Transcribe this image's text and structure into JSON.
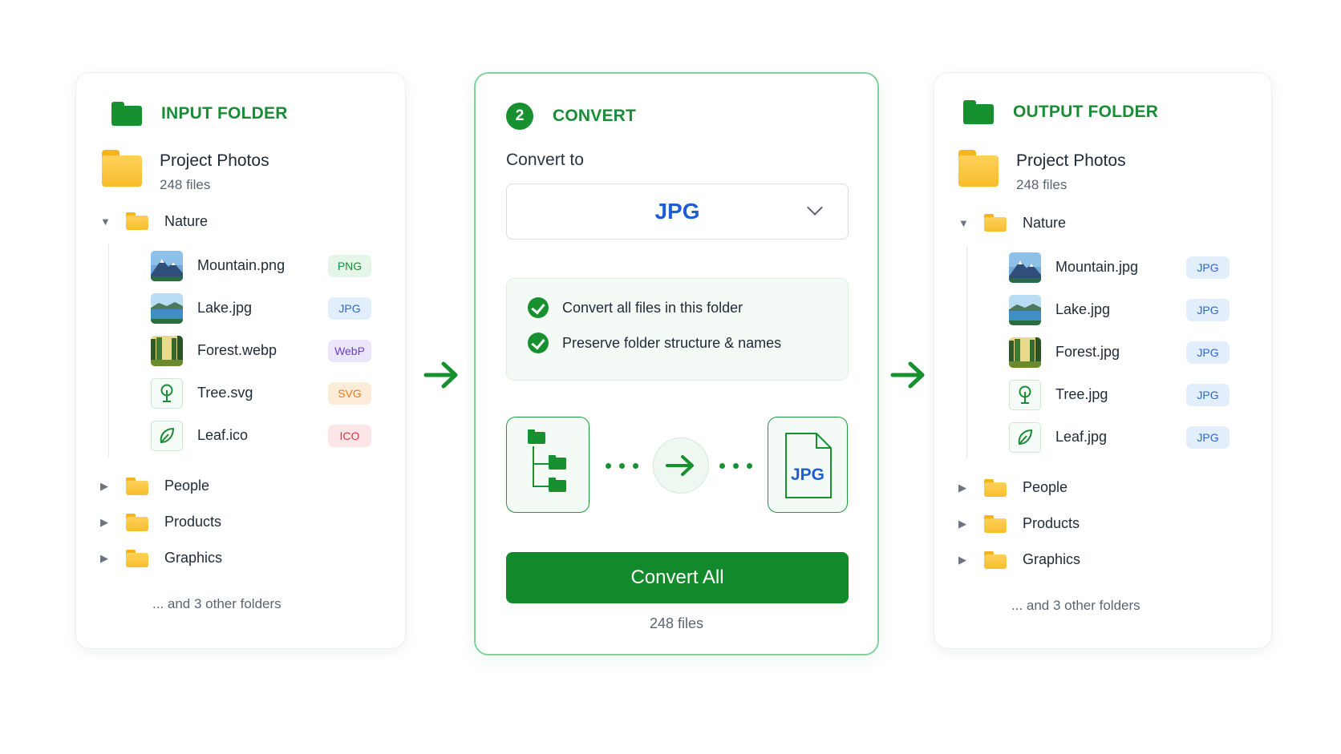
{
  "input": {
    "header": "INPUT FOLDER",
    "root": {
      "name": "Project Photos",
      "count": "248 files"
    },
    "expanded_folder": "Nature",
    "files": [
      {
        "name": "Mountain.png",
        "type": "PNG",
        "thumb": "mountain"
      },
      {
        "name": "Lake.jpg",
        "type": "JPG",
        "thumb": "lake"
      },
      {
        "name": "Forest.webp",
        "type": "WebP",
        "thumb": "forest"
      },
      {
        "name": "Tree.svg",
        "type": "SVG",
        "thumb": "tree-icon"
      },
      {
        "name": "Leaf.ico",
        "type": "ICO",
        "thumb": "leaf-icon"
      }
    ],
    "collapsed_folders": [
      "People",
      "Products",
      "Graphics"
    ],
    "other_folders": "... and 3 other folders"
  },
  "convert": {
    "step": "2",
    "header": "CONVERT",
    "convert_to_label": "Convert to",
    "selected_format": "JPG",
    "options": [
      "Convert all files in this folder",
      "Preserve folder structure & names"
    ],
    "target_file_label": "JPG",
    "button_label": "Convert All",
    "count": "248 files"
  },
  "output": {
    "header": "OUTPUT FOLDER",
    "root": {
      "name": "Project Photos",
      "count": "248 files"
    },
    "expanded_folder": "Nature",
    "files": [
      {
        "name": "Mountain.jpg",
        "type": "JPG",
        "thumb": "mountain"
      },
      {
        "name": "Lake.jpg",
        "type": "JPG",
        "thumb": "lake"
      },
      {
        "name": "Forest.jpg",
        "type": "JPG",
        "thumb": "forest"
      },
      {
        "name": "Tree.jpg",
        "type": "JPG",
        "thumb": "tree-icon"
      },
      {
        "name": "Leaf.jpg",
        "type": "JPG",
        "thumb": "leaf-icon"
      }
    ],
    "collapsed_folders": [
      "People",
      "Products",
      "Graphics"
    ],
    "other_folders": "... and 3 other folders"
  },
  "colors": {
    "accent_green": "#17912f",
    "folder_yellow": "#f8bd2c",
    "jpg_blue": "#1c5fd4"
  }
}
